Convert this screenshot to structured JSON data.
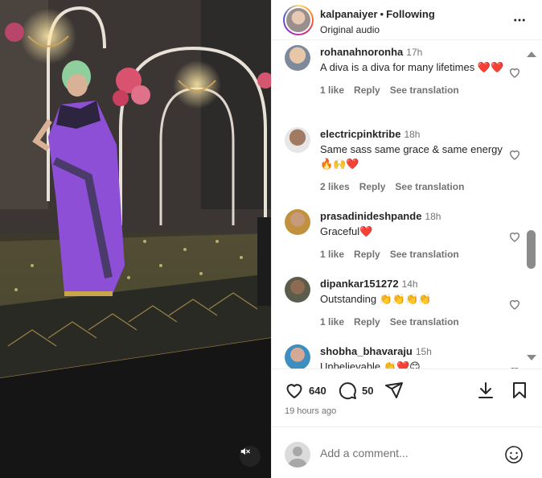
{
  "post": {
    "username": "kalpanaiyer",
    "separator": "•",
    "follow_status": "Following",
    "audio": "Original audio"
  },
  "comments": [
    {
      "user": "rohanahnoronha",
      "time": "17h",
      "text": "A diva is a diva for many lifetimes ❤️❤️",
      "likes": "1 like",
      "reply": "Reply",
      "translate": "See translation"
    },
    {
      "user": "electricpinktribe",
      "time": "18h",
      "text": "Same sass same grace & same energy 🔥🙌❤️",
      "likes": "2 likes",
      "reply": "Reply",
      "translate": "See translation"
    },
    {
      "user": "prasadinideshpande",
      "time": "18h",
      "text": "Graceful❤️",
      "likes": "1 like",
      "reply": "Reply",
      "translate": "See translation"
    },
    {
      "user": "dipankar151272",
      "time": "14h",
      "text": "Outstanding 👏👏👏👏",
      "likes": "1 like",
      "reply": "Reply",
      "translate": "See translation"
    },
    {
      "user": "shobha_bhavaraju",
      "time": "15h",
      "text": "Unbelievable 👏❤️😊",
      "likes": "",
      "reply": "",
      "translate": ""
    }
  ],
  "actions": {
    "like_count": "640",
    "comment_count": "50",
    "posted": "19 hours ago"
  },
  "add_comment": {
    "placeholder": "Add a comment..."
  },
  "icons": {
    "more": "more-options-icon",
    "like": "heart-icon",
    "comment": "comment-bubble-icon",
    "share": "send-icon",
    "download": "download-icon",
    "save": "bookmark-icon",
    "emoji": "emoji-icon",
    "mute": "muted-speaker-icon"
  },
  "colors": {
    "text": "#262626",
    "muted": "#737373",
    "heart_red": "#ed1c24"
  }
}
